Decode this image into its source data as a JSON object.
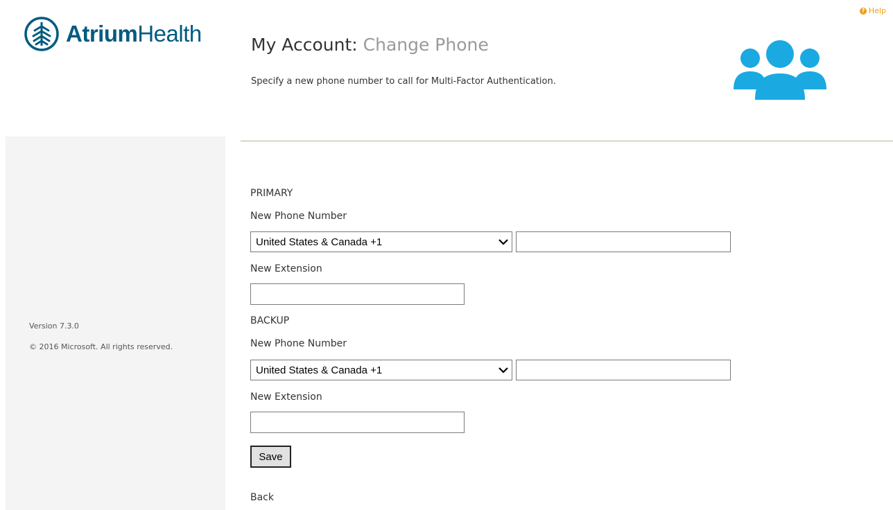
{
  "help": {
    "label": "Help",
    "icon": "question-circle-icon"
  },
  "logo": {
    "bold_text": "Atrium",
    "light_text": "Health",
    "icon": "atrium-leaf-logo",
    "color": "#005b7f"
  },
  "header": {
    "title_prefix": "My Account:",
    "title_suffix": "Change Phone",
    "description": "Specify a new phone number to call for Multi-Factor Authentication.",
    "users_icon": "users-group-icon",
    "users_icon_color": "#1aa9e1"
  },
  "sidebar": {
    "version": "Version 7.3.0",
    "copyright": "© 2016 Microsoft. All rights reserved."
  },
  "form": {
    "primary": {
      "heading": "PRIMARY",
      "phone_label": "New Phone Number",
      "country": "United States & Canada +1",
      "phone_value": "",
      "extension_label": "New Extension",
      "extension_value": ""
    },
    "backup": {
      "heading": "BACKUP",
      "phone_label": "New Phone Number",
      "country": "United States & Canada +1",
      "phone_value": "",
      "extension_label": "New Extension",
      "extension_value": ""
    },
    "save_label": "Save",
    "back_label": "Back"
  }
}
